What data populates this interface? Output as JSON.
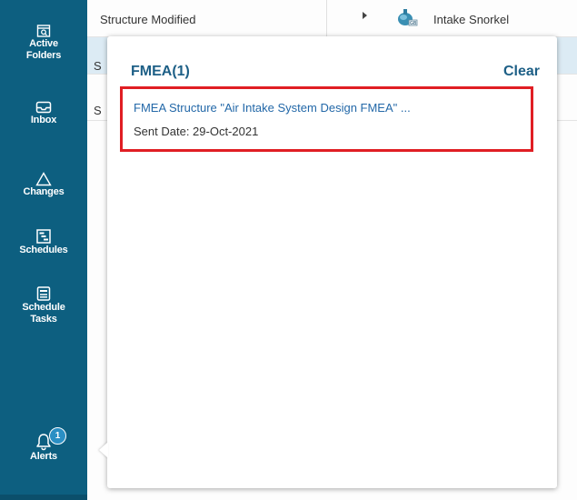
{
  "nav": {
    "items": [
      {
        "label": "Active\nFolders",
        "icon": "folder-search-icon"
      },
      {
        "label": "Inbox",
        "icon": "inbox-icon"
      },
      {
        "label": "Changes",
        "icon": "delta-icon"
      },
      {
        "label": "Schedules",
        "icon": "schedule-chart-icon"
      },
      {
        "label": "Schedule\nTasks",
        "icon": "schedule-tasks-icon"
      },
      {
        "label": "Alerts",
        "icon": "bell-icon",
        "badge": "1"
      }
    ]
  },
  "list": {
    "rows": [
      {
        "col1": "Structure Modified",
        "col2": "Intake Snorkel"
      },
      {
        "col1": "S",
        "col2": ""
      },
      {
        "col1": "S",
        "col2": ""
      }
    ]
  },
  "popover": {
    "title": "FMEA(1)",
    "clear_label": "Clear",
    "alerts": [
      {
        "link_text": "FMEA Structure \"Air Intake System Design FMEA\" ...",
        "sent_date": "Sent Date: 29-Oct-2021"
      }
    ]
  },
  "colors": {
    "rail": "#0d5f80",
    "accent": "#1d5f86",
    "link": "#2368a8",
    "highlight_border": "#e01e24",
    "badge": "#2b8fc4",
    "selected_row": "#dcebf4"
  }
}
